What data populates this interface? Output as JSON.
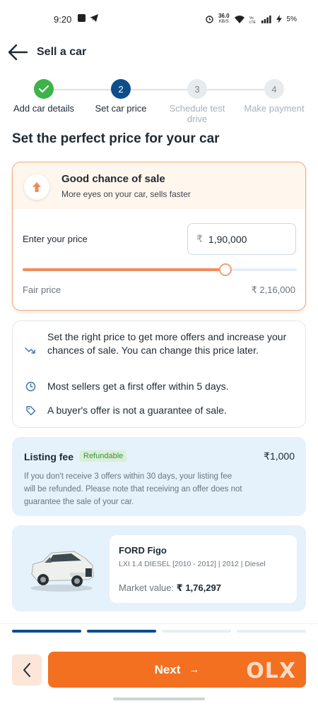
{
  "status_bar": {
    "time": "9:20",
    "speed_value": "36.0",
    "speed_unit": "KB/S",
    "battery": "5%"
  },
  "header": {
    "title": "Sell a car"
  },
  "stepper": {
    "steps": [
      {
        "number": "1",
        "label": "Add car details",
        "state": "done"
      },
      {
        "number": "2",
        "label": "Set car price",
        "state": "active"
      },
      {
        "number": "3",
        "label": "Schedule test drive",
        "state": "todo"
      },
      {
        "number": "4",
        "label": "Make payment",
        "state": "todo"
      }
    ]
  },
  "page_title": "Set the perfect price for your car",
  "price_card": {
    "title": "Good chance of sale",
    "subtitle": "More eyes on your car, sells faster",
    "input_label": "Enter your price",
    "currency_symbol": "₹",
    "price_value": "1,90,000",
    "slider_fraction": 0.74,
    "fair_label": "Fair price",
    "fair_value": "₹ 2,16,000"
  },
  "info": {
    "items": [
      {
        "icon": "trend-down-icon",
        "text": "Set the right price to get more offers and increase your chances of sale. You can change this price later."
      },
      {
        "icon": "clock-icon",
        "text": "Most sellers get a first offer within 5 days."
      },
      {
        "icon": "tag-icon",
        "text": "A buyer's offer is not a guarantee of sale."
      }
    ]
  },
  "listing_fee": {
    "title": "Listing fee",
    "badge": "Refundable",
    "amount": "₹1,000",
    "description": "If you don't receive 3 offers within 30 days, your listing fee will be refunded. Please note that receiving an offer does not guarantee the sale of your car."
  },
  "car": {
    "name": "FORD Figo",
    "variant": "LXI 1.4 DIESEL [2010 - 2012] | 2012 | Diesel",
    "market_label": "Market value:",
    "market_value": "₹ 1,76,297"
  },
  "progress": {
    "completed_segments": 2,
    "total_segments": 4
  },
  "footer": {
    "next_label": "Next",
    "next_arrow": "→",
    "brand_mark": "OLX"
  },
  "colors": {
    "accent": "#f37021",
    "primary_blue": "#0d4d8c",
    "success_green": "#3db34a",
    "info_bg": "#e5f1fb"
  }
}
